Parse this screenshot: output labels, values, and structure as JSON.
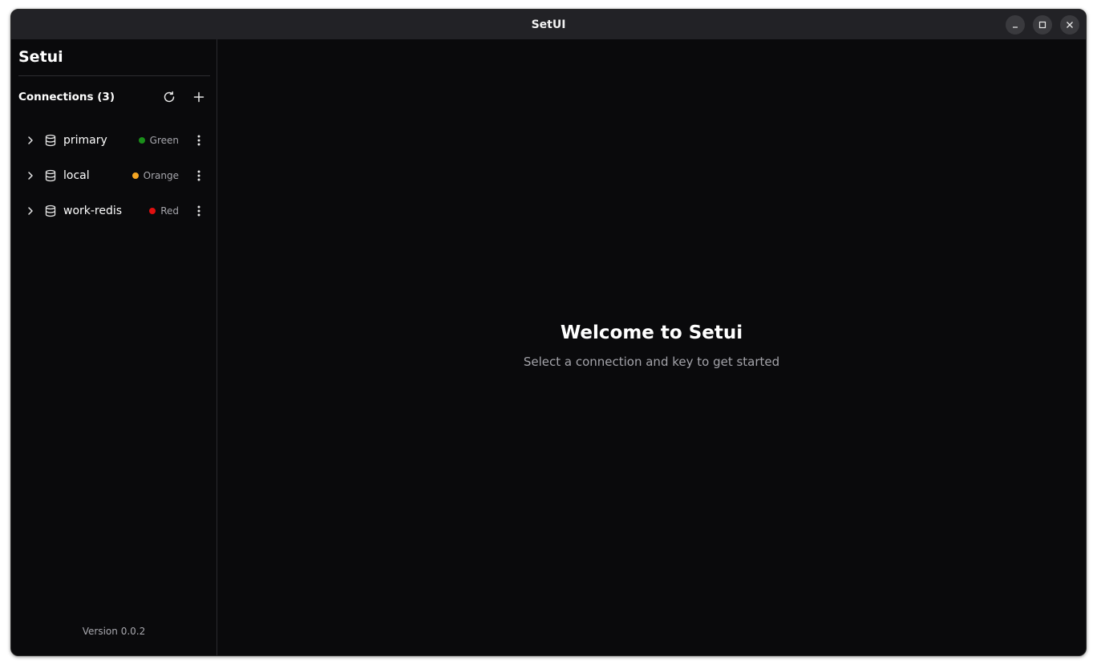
{
  "window": {
    "title": "SetUI"
  },
  "sidebar": {
    "brand": "Setui",
    "connections_label": "Connections (3)",
    "refresh_icon": "refresh-icon",
    "add_icon": "plus-icon",
    "connections": [
      {
        "name": "primary",
        "tag": "Green",
        "color": "#1a8f1a"
      },
      {
        "name": "local",
        "tag": "Orange",
        "color": "#f5a623"
      },
      {
        "name": "work-redis",
        "tag": "Red",
        "color": "#e01010"
      }
    ],
    "version": "Version 0.0.2"
  },
  "main": {
    "welcome_title": "Welcome to Setui",
    "welcome_subtitle": "Select a connection and key to get started"
  }
}
